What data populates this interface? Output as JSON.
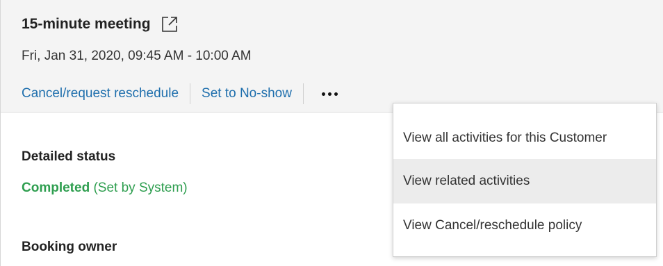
{
  "meeting": {
    "title": "15-minute meeting",
    "datetime": "Fri, Jan 31, 2020, 09:45 AM - 10:00 AM"
  },
  "actions": {
    "cancel_label": "Cancel/request reschedule",
    "noshow_label": "Set to No-show",
    "more_icon": "more-horizontal-icon"
  },
  "menu": {
    "items": [
      {
        "label": "View all activities for this Customer"
      },
      {
        "label": "View related activities"
      },
      {
        "label": "View Cancel/reschedule policy"
      }
    ]
  },
  "details": {
    "status_heading": "Detailed status",
    "status_value": "Completed",
    "status_note": "(Set by System)",
    "owner_heading": "Booking owner"
  },
  "colors": {
    "link": "#1f6fad",
    "status": "#2e9e4f",
    "header_bg": "#f4f4f4",
    "menu_hover": "#ececec"
  }
}
